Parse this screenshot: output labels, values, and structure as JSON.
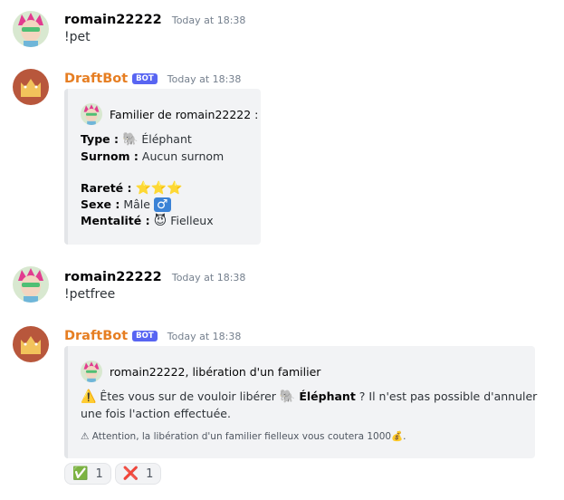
{
  "messages": [
    {
      "author": "romain22222",
      "timestamp": "Today at 18:38",
      "content": "!pet"
    },
    {
      "author": "DraftBot",
      "badge": "BOT",
      "timestamp": "Today at 18:38",
      "embed": {
        "author": "Familier de romain22222 :",
        "type_label": "Type :",
        "type_emoji": "🐘",
        "type_value": "Éléphant",
        "nick_label": "Surnom :",
        "nick_value": "Aucun surnom",
        "rarity_label": "Rareté :",
        "rarity_stars": "⭐⭐⭐",
        "sex_label": "Sexe :",
        "sex_value": "Mâle",
        "sex_emoji": "♂",
        "mood_label": "Mentalité :",
        "mood_emoji": "😈",
        "mood_value": "Fielleux"
      }
    },
    {
      "author": "romain22222",
      "timestamp": "Today at 18:38",
      "content": "!petfree"
    },
    {
      "author": "DraftBot",
      "badge": "BOT",
      "timestamp": "Today at 18:38",
      "embed": {
        "author": "romain22222, libération d'un familier",
        "warn_emoji": "⚠️",
        "desc_part1": "Êtes vous sur de vouloir libérer",
        "pet_emoji": "🐘",
        "pet_name": "Éléphant",
        "desc_part2": "? Il n'est pas possible d'annuler",
        "desc_line2": "une fois l'action effectuée.",
        "footer": "⚠ Attention, la libération d'un familier fielleux vous coutera 1000💰."
      },
      "reactions": [
        {
          "emoji": "✅",
          "count": "1"
        },
        {
          "emoji": "❌",
          "count": "1"
        }
      ]
    }
  ],
  "colors": {
    "bot_name": "#e67e22",
    "badge": "#5865f2",
    "embed_bg": "#f2f3f5",
    "embed_border": "#e3e5e8"
  }
}
